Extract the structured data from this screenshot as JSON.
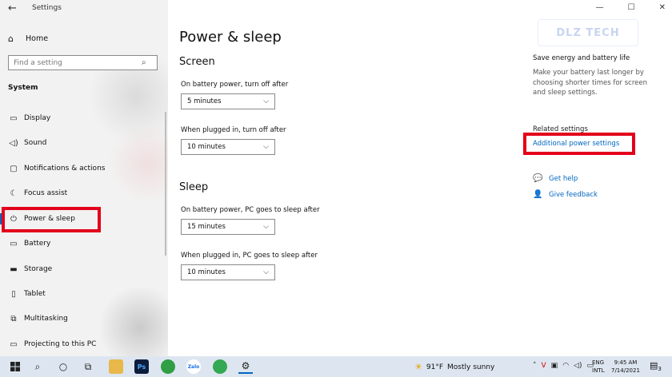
{
  "window": {
    "app_title": "Settings",
    "controls": {
      "minimize": "—",
      "maximize": "☐",
      "close": "✕"
    }
  },
  "sidebar": {
    "home_label": "Home",
    "search_placeholder": "Find a setting",
    "section_label": "System",
    "items": [
      {
        "label": "Display",
        "icon": "display-icon",
        "glyph": "▭"
      },
      {
        "label": "Sound",
        "icon": "sound-icon",
        "glyph": "🔈"
      },
      {
        "label": "Notifications & actions",
        "icon": "notifications-icon",
        "glyph": "▢"
      },
      {
        "label": "Focus assist",
        "icon": "focus-assist-icon",
        "glyph": "☾"
      },
      {
        "label": "Power & sleep",
        "icon": "power-icon",
        "glyph": "⏻",
        "selected": true
      },
      {
        "label": "Battery",
        "icon": "battery-icon",
        "glyph": "▭"
      },
      {
        "label": "Storage",
        "icon": "storage-icon",
        "glyph": "▬"
      },
      {
        "label": "Tablet",
        "icon": "tablet-icon",
        "glyph": "▯"
      },
      {
        "label": "Multitasking",
        "icon": "multitasking-icon",
        "glyph": "⧉"
      },
      {
        "label": "Projecting to this PC",
        "icon": "projecting-icon",
        "glyph": "▭"
      }
    ]
  },
  "main": {
    "title": "Power & sleep",
    "screen": {
      "heading": "Screen",
      "battery_label": "On battery power, turn off after",
      "battery_value": "5 minutes",
      "plugged_label": "When plugged in, turn off after",
      "plugged_value": "10 minutes"
    },
    "sleep": {
      "heading": "Sleep",
      "battery_label": "On battery power, PC goes to sleep after",
      "battery_value": "15 minutes",
      "plugged_label": "When plugged in, PC goes to sleep after",
      "plugged_value": "10 minutes"
    }
  },
  "aside": {
    "logo_text": "DLZ TECH",
    "tip_title": "Save energy and battery life",
    "tip_desc": "Make your battery last longer by choosing shorter times for screen and sleep settings.",
    "related_heading": "Related settings",
    "related_link": "Additional power settings",
    "get_help": "Get help",
    "give_feedback": "Give feedback"
  },
  "taskbar": {
    "weather_temp": "91°F",
    "weather_desc": "Mostly sunny",
    "lang_line1": "ENG",
    "lang_line2": "INTL",
    "time": "9:45 AM",
    "date": "7/14/2021",
    "notif_count": "3",
    "accent": "#0067c0",
    "highlight": "#e3001b"
  }
}
